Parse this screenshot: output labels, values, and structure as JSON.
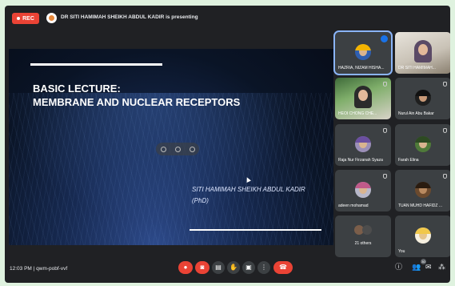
{
  "recording": {
    "label": "REC"
  },
  "presenting": {
    "text": "DR SITI HAMIMAH SHEIKH ABDUL KADIR is presenting"
  },
  "slide": {
    "title_line1": "BASIC LECTURE:",
    "title_line2": "MEMBRANE AND NUCLEAR RECEPTORS",
    "author_line1": "SITI HAMIMAH SHEIKH ABDUL KADIR",
    "author_line2": "(PhD)"
  },
  "participants": [
    {
      "name": "HAZRIA, NIZAM HISHA..."
    },
    {
      "name": "DR SITI HAMIMAH..."
    },
    {
      "name": "HEOI CHONG CHE..."
    },
    {
      "name": "Nurul Ain Abu Bakar"
    },
    {
      "name": "Raja Nur Firzanah Syaza"
    },
    {
      "name": "Farah Elina"
    },
    {
      "name": "adeen mohamad"
    },
    {
      "name": "TUAN MUHD HAFIDZ ..."
    },
    {
      "name": "21 others"
    },
    {
      "name": "You"
    }
  ],
  "meeting": {
    "time": "12:03 PM",
    "separator": "|",
    "code": "qwm-pobf-vvf"
  },
  "people_count": "30",
  "colors": {
    "accent": "#8ab4f8",
    "danger": "#ea4335",
    "surface": "#3c4043",
    "background": "#202124"
  }
}
